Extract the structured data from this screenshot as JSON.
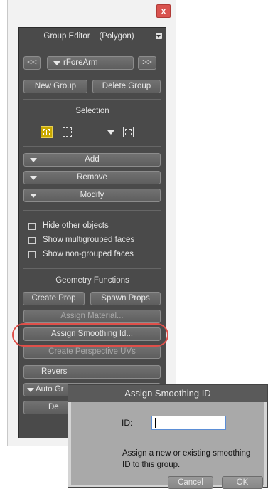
{
  "window": {
    "close_label": "x"
  },
  "panel": {
    "title": "Group Editor    (Polygon)",
    "nav_prev": "<<",
    "group_name": "rForeArm",
    "nav_next": ">>",
    "new_group": "New Group",
    "delete_group": "Delete Group",
    "selection_label": "Selection",
    "menus": {
      "add": "Add",
      "remove": "Remove",
      "modify": "Modify"
    },
    "options": {
      "hide_other_objects": "Hide other objects",
      "show_multigrouped_faces": "Show multigrouped faces",
      "show_non_grouped_faces": "Show non-grouped faces"
    },
    "geometry_label": "Geometry Functions",
    "create_prop": "Create Prop",
    "spawn_props": "Spawn Props",
    "assign_material": "Assign Material...",
    "assign_smoothing": "Assign Smoothing Id...",
    "create_perspective_uvs": "Create Perspective UVs",
    "reverse_partial": "Revers",
    "auto_partial": "Auto Gr",
    "de_partial": "De"
  },
  "dialog": {
    "title": "Assign Smoothing ID",
    "id_label": "ID:",
    "id_value": "",
    "help_text": "Assign a new or existing smoothing ID to this group.",
    "cancel": "Cancel",
    "ok": "OK"
  },
  "colors": {
    "panel_bg": "#4a4a4a",
    "highlight_ring": "#e0504a",
    "selection_active": "#c9a800",
    "close_button": "#d9534f"
  }
}
